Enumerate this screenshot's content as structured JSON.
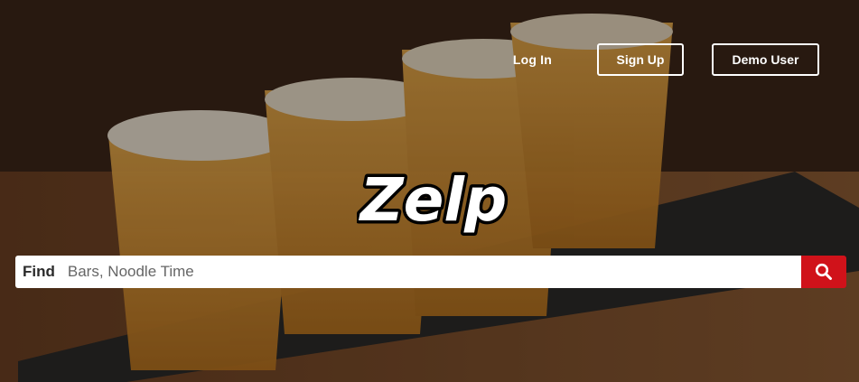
{
  "nav": {
    "login_label": "Log In",
    "signup_label": "Sign Up",
    "demo_label": "Demo User"
  },
  "brand": {
    "logo_text": "Zelp"
  },
  "search": {
    "find_label": "Find",
    "placeholder": "Bars, Noodle Time",
    "value": "",
    "button_icon": "search-icon"
  },
  "colors": {
    "search_button": "#d0121a",
    "text": "#ffffff"
  }
}
